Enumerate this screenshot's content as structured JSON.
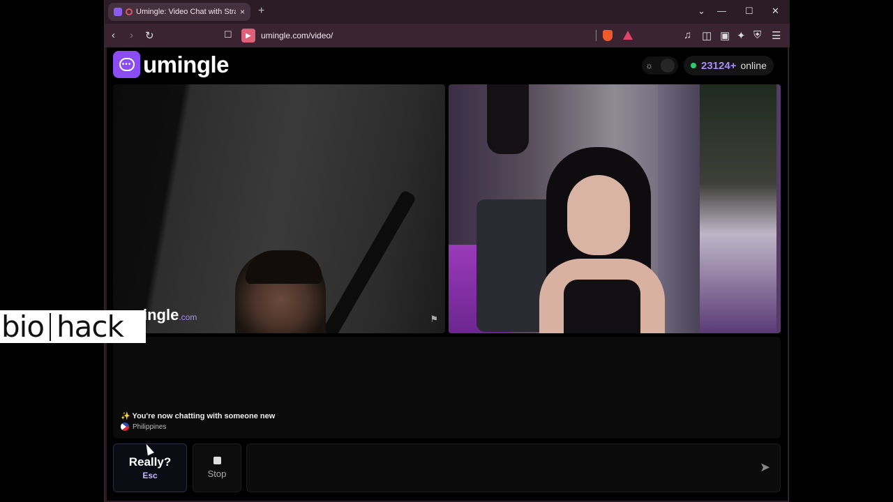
{
  "browser": {
    "tab_title": "Umingle: Video Chat with Stra",
    "tab_close": "×",
    "new_tab": "+",
    "url": "umingle.com/video/",
    "controls": {
      "dropdown": "⌄",
      "minimize": "—",
      "maximize": "☐",
      "close": "✕"
    }
  },
  "header": {
    "logo_text": "umingle",
    "online_count": "23124+",
    "online_label": "online"
  },
  "video": {
    "watermark": "umingle",
    "watermark_domain": ".com"
  },
  "chat": {
    "system_message": "✨ You're now chatting with someone new",
    "country": "Philippines"
  },
  "controls": {
    "really_label": "Really?",
    "really_key": "Esc",
    "stop_label": "Stop",
    "message_placeholder": ""
  },
  "overlay": {
    "brand_left": "bio",
    "brand_right": "hack"
  },
  "colors": {
    "accent": "#8a4df2",
    "online_dot": "#2ecc71"
  }
}
